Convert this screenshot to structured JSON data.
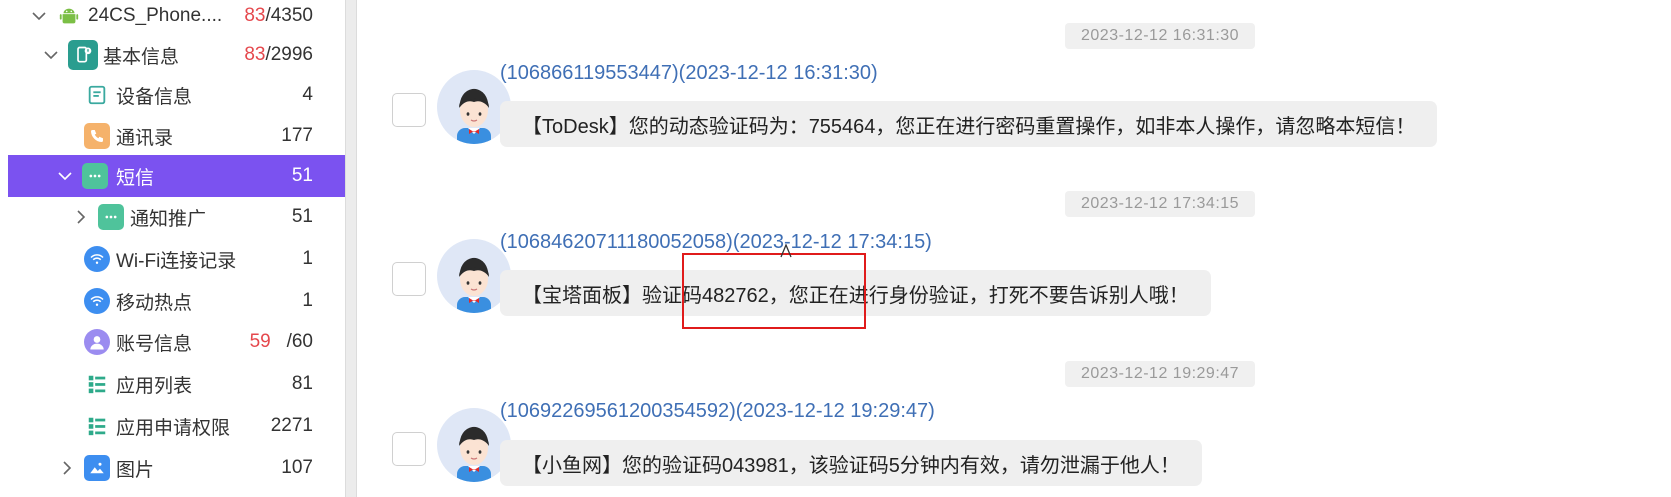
{
  "tree": [
    {
      "label": "24CS_Phone....",
      "count_red": "83",
      "count": "/4350",
      "icon": "android-icon",
      "level": 0,
      "chevron": "down"
    },
    {
      "label": "基本信息",
      "count_red": "83",
      "count": "/2996",
      "icon": "phone-info-icon",
      "level": 1,
      "chevron": "down"
    },
    {
      "label": "设备信息",
      "count_red": "",
      "count": "4",
      "icon": "device-info-icon",
      "level": 2,
      "chevron": ""
    },
    {
      "label": "通讯录",
      "count_red": "",
      "count": "177",
      "icon": "contacts-icon",
      "level": 2,
      "chevron": ""
    },
    {
      "label": "短信",
      "count_red": "",
      "count": "51",
      "icon": "sms-icon",
      "level": 1,
      "chevron": "down",
      "active": true
    },
    {
      "label": "通知推广",
      "count_red": "",
      "count": "51",
      "icon": "sms-icon",
      "level": 2,
      "chevron": "right"
    },
    {
      "label": "Wi-Fi连接记录",
      "count_red": "",
      "count": "1",
      "icon": "wifi-icon",
      "level": 2,
      "chevron": ""
    },
    {
      "label": "移动热点",
      "count_red": "",
      "count": "1",
      "icon": "hotspot-icon",
      "level": 2,
      "chevron": ""
    },
    {
      "label": "账号信息",
      "count_red": "59",
      "count": "/60",
      "icon": "account-icon",
      "level": 2,
      "chevron": ""
    },
    {
      "label": "应用列表",
      "count_red": "",
      "count": "81",
      "icon": "app-list-icon",
      "level": 2,
      "chevron": ""
    },
    {
      "label": "应用申请权限",
      "count_red": "",
      "count": "2271",
      "icon": "app-permission-icon",
      "level": 2,
      "chevron": ""
    },
    {
      "label": "图片",
      "count_red": "",
      "count": "107",
      "icon": "image-icon",
      "level": 1,
      "chevron": "right"
    }
  ],
  "messages": [
    {
      "timestamp": "2023-12-12 16:31:30",
      "sender": "(106866119553447)(2023-12-12 16:31:30)",
      "body": "【ToDesk】您的动态验证码为：755464，您正在进行密码重置操作，如非本人操作，请忽略本短信！"
    },
    {
      "timestamp": "2023-12-12 17:34:15",
      "sender": "(1068462071118005205​8)(2023-12-12 17:34:15)",
      "body": "【宝塔面板】验证码482762，您正在进行身份验证，打死不要告诉别人哦！"
    },
    {
      "timestamp": "2023-12-12 19:29:47",
      "sender": "(1069226956120035459​2)(2023-12-12 19:29:47)",
      "body": "【小鱼网】您的验证码043981，该验证码5分钟内有效，请勿泄漏于他人！"
    }
  ],
  "colors": {
    "accent": "#7b52f0",
    "sender": "#3f6fb5",
    "count_red": "#e5484d",
    "highlight": "#e01b1b"
  }
}
